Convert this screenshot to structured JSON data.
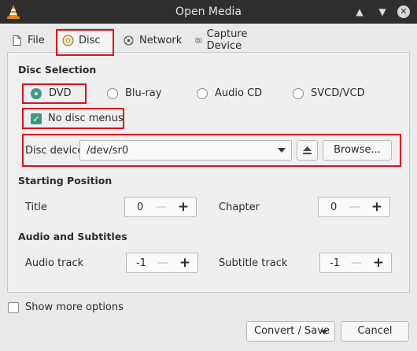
{
  "window": {
    "title": "Open Media"
  },
  "tabs": [
    {
      "label": "File",
      "icon": "file-icon"
    },
    {
      "label": "Disc",
      "icon": "disc-icon"
    },
    {
      "label": "Network",
      "icon": "network-icon"
    },
    {
      "label": "Capture Device",
      "icon": "capture-device-icon"
    }
  ],
  "disc_selection": {
    "title": "Disc Selection",
    "options": [
      "DVD",
      "Blu-ray",
      "Audio CD",
      "SVCD/VCD"
    ],
    "selected": "DVD",
    "no_disc_menus_label": "No disc menus",
    "no_disc_menus_checked": true,
    "device_label": "Disc device",
    "device_value": "/dev/sr0",
    "browse_label": "Browse..."
  },
  "starting_position": {
    "title": "Starting Position",
    "title_label": "Title",
    "title_value": "0",
    "chapter_label": "Chapter",
    "chapter_value": "0"
  },
  "audio_subtitles": {
    "title": "Audio and Subtitles",
    "audio_label": "Audio track",
    "audio_value": "-1",
    "subtitle_label": "Subtitle track",
    "subtitle_value": "-1"
  },
  "footer": {
    "show_more_label": "Show more options",
    "show_more_checked": false,
    "convert_label": "Convert / Save",
    "cancel_label": "Cancel"
  },
  "colors": {
    "accent": "#3a9b83",
    "highlight": "#e0101e",
    "titlebar": "#2f2f2f"
  }
}
